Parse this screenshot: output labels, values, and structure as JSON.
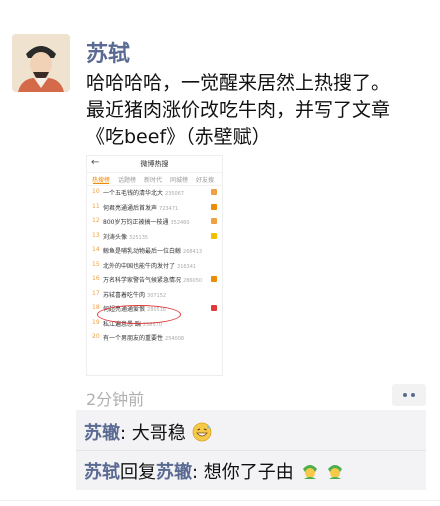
{
  "post": {
    "author": "苏轼",
    "text_lines": [
      "哈哈哈哈，一觉醒来居然上热搜了。",
      "最近猪肉涨价改吃牛肉，并写了文章",
      "《吃beef》（赤壁赋）"
    ],
    "time": "2分钟前"
  },
  "screenshot": {
    "title": "微博热搜",
    "back": "←",
    "tabs": [
      "热搜榜",
      "话题榜",
      "新时代",
      "同城榜",
      "好友搜"
    ],
    "rows": [
      {
        "rank": "10",
        "title": "一个五毛钱的清华北大",
        "count": "235067",
        "badge_color": "#f0a040"
      },
      {
        "rank": "11",
        "title": "何君亮通通后首发声",
        "count": "723471",
        "badge_color": "#f08a00"
      },
      {
        "rank": "12",
        "title": "800岁万钧正被搞一枝通",
        "count": "352460",
        "badge_color": "#f0a040"
      },
      {
        "rank": "13",
        "title": "刘涛头像",
        "count": "325135",
        "badge_color": "#f0c000"
      },
      {
        "rank": "14",
        "title": "鲸鱼是哺乳动物最后一位白鲸",
        "count": "268413",
        "badge_color": ""
      },
      {
        "rank": "15",
        "title": "北外的中国也能牛肉发付了",
        "count": "316341",
        "badge_color": ""
      },
      {
        "rank": "16",
        "title": "万名科学家警告气候紧急情况",
        "count": "286050",
        "badge_color": "#f08a00"
      },
      {
        "rank": "17",
        "title": "苏轼喜着吃牛肉",
        "count": "307152",
        "badge_color": ""
      },
      {
        "rank": "18",
        "title": "何超亮通通爱恨",
        "count": "280516",
        "badge_color": "#e03a3a"
      },
      {
        "rank": "19",
        "title": "私江遍息愚 踹",
        "count": "258570",
        "badge_color": ""
      },
      {
        "rank": "20",
        "title": "有一个男朋友的重要性",
        "count": "254008",
        "badge_color": ""
      }
    ]
  },
  "comments": [
    {
      "name": "苏辙",
      "text": ": 大哥稳",
      "emoji": "grinning-sweat-emoji"
    },
    {
      "name": "苏轼",
      "reply_word": "回复",
      "reply_to": "苏辙",
      "text": ": 想你了子由",
      "emoji": "green-plant-emoji"
    }
  ],
  "colors": {
    "name": "#5a6a92",
    "accent": "#f08a00",
    "highlight_circle": "#e23a3a"
  }
}
